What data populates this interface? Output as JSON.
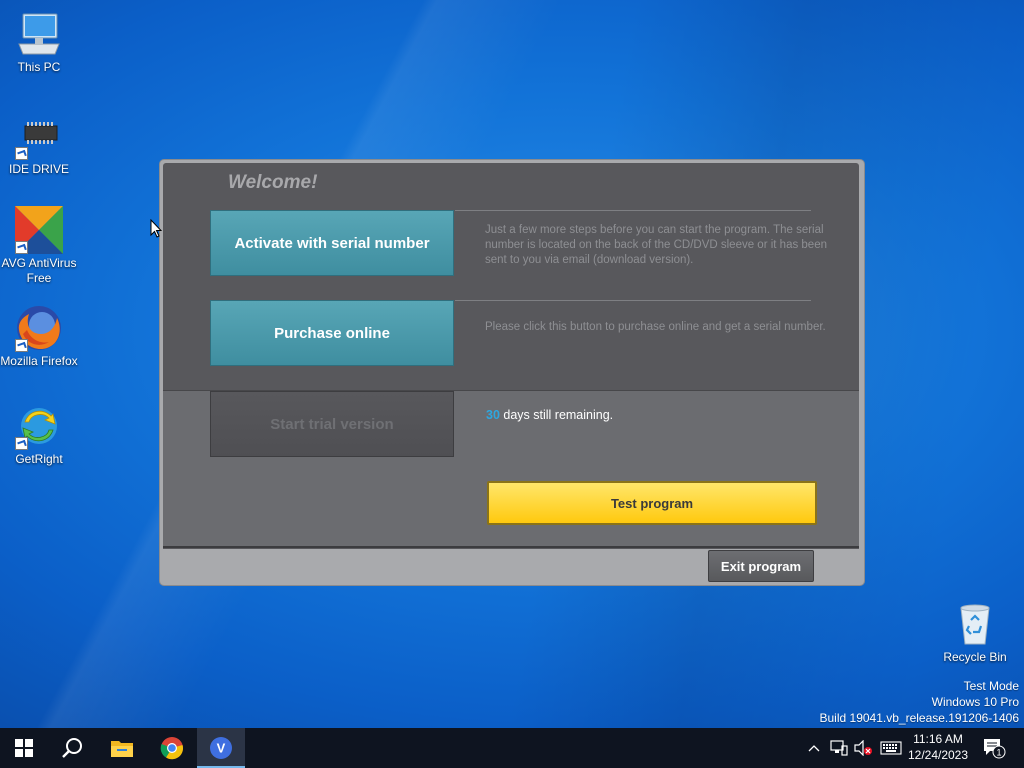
{
  "desktop": {
    "icons": [
      {
        "label": "This PC"
      },
      {
        "label": "IDE DRIVE"
      },
      {
        "label": "AVG AntiVirus Free"
      },
      {
        "label": "Mozilla Firefox"
      },
      {
        "label": "GetRight"
      },
      {
        "label": "Recycle Bin"
      }
    ],
    "watermark": {
      "line1": "Test Mode",
      "line2": "Windows 10 Pro",
      "line3": "Build 19041.vb_release.191206-1406"
    }
  },
  "dialog": {
    "title": "Welcome!",
    "activate_button": "Activate with serial number",
    "activate_desc": "Just a few more steps before you can start the program. The serial number is located on the back of the CD/DVD sleeve or it has been sent to you via email (download version).",
    "purchase_button": "Purchase online",
    "purchase_desc": "Please click this button to purchase online and get a serial number.",
    "trial_button": "Start trial version",
    "trial_days": "30",
    "trial_suffix": " days still remaining.",
    "test_button": "Test program",
    "exit_button": "Exit program"
  },
  "taskbar": {
    "start_icon": "windows-logo-icon",
    "search_icon": "search-icon",
    "pinned": [
      "file-explorer-icon",
      "chrome-icon",
      "v-app-icon"
    ],
    "tray_icons": [
      "chevron-up-icon",
      "network-icon",
      "volume-muted-icon",
      "keyboard-icon"
    ],
    "time": "11:16 AM",
    "date": "12/24/2023",
    "notification_count": "1"
  },
  "colors": {
    "accent_teal": "#4a9aac",
    "test_button_yellow": "#ffd530",
    "dialog_dark": "#58585c",
    "trial_days_blue": "#2ea7e0"
  }
}
